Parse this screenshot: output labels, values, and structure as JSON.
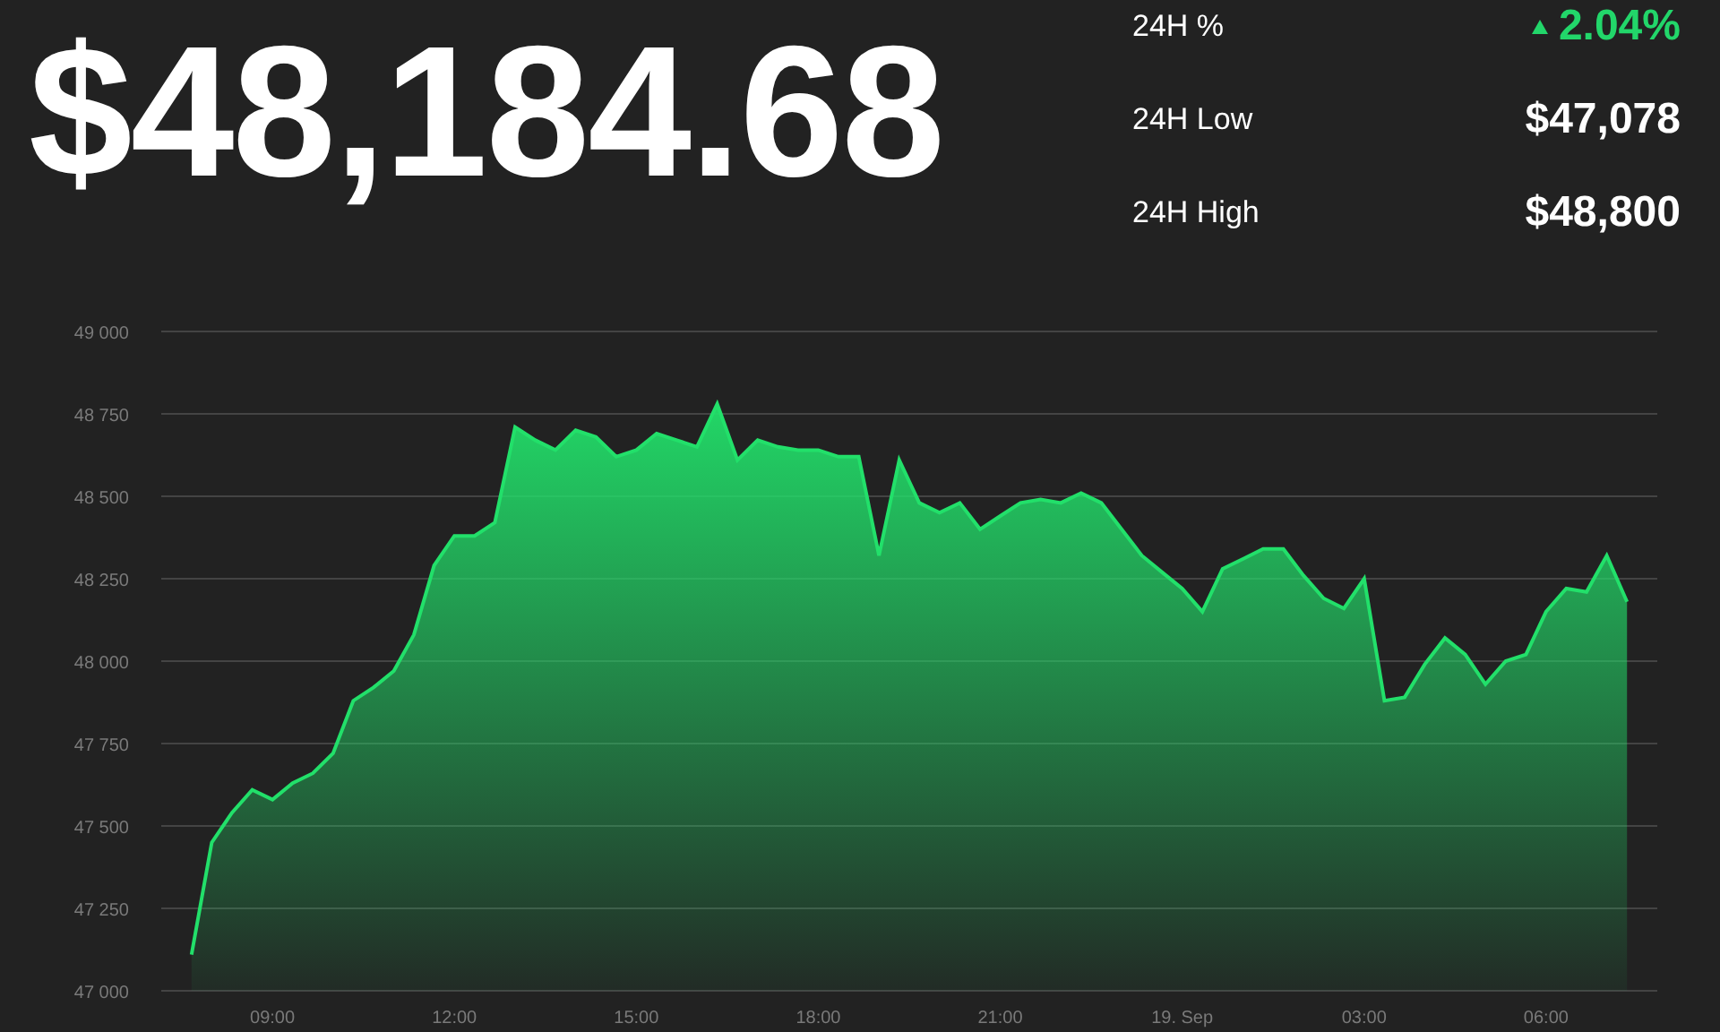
{
  "price": "$48,184.68",
  "stats": [
    {
      "label": "24H %",
      "value": "2.04%",
      "kind": "change",
      "rising": true
    },
    {
      "label": "24H Low",
      "value": "$47,078",
      "kind": "plain"
    },
    {
      "label": "24H High",
      "value": "$48,800",
      "kind": "plain"
    }
  ],
  "chart": {
    "chart_data": {
      "type": "area",
      "categories": [
        null,
        null,
        null,
        null,
        "09:00",
        null,
        null,
        null,
        null,
        null,
        null,
        null,
        null,
        "12:00",
        null,
        null,
        null,
        null,
        null,
        null,
        null,
        null,
        "15:00",
        null,
        null,
        null,
        null,
        null,
        null,
        null,
        null,
        "18:00",
        null,
        null,
        null,
        null,
        null,
        null,
        null,
        null,
        "21:00",
        null,
        null,
        null,
        null,
        null,
        null,
        null,
        null,
        "19. Sep",
        null,
        null,
        null,
        null,
        null,
        null,
        null,
        null,
        "03:00",
        null,
        null,
        null,
        null,
        null,
        null,
        null,
        null,
        "06:00",
        null,
        null,
        null,
        null
      ],
      "series": [
        {
          "color": "#22e06a",
          "values": [
            47110,
            47450,
            47540,
            47610,
            47580,
            47630,
            47660,
            47720,
            47880,
            47920,
            47970,
            48080,
            48290,
            48380,
            48380,
            48420,
            48710,
            48670,
            48640,
            48700,
            48680,
            48620,
            48640,
            48690,
            48670,
            48650,
            48780,
            48610,
            48670,
            48650,
            48640,
            48640,
            48620,
            48620,
            48320,
            48610,
            48480,
            48450,
            48480,
            48400,
            48440,
            48480,
            48490,
            48480,
            48510,
            48480,
            48400,
            48320,
            48270,
            48220,
            48150,
            48280,
            48310,
            48340,
            48340,
            48260,
            48190,
            48160,
            48250,
            47880,
            47890,
            47990,
            48070,
            48020,
            47930,
            48000,
            48020,
            48150,
            48220,
            48210,
            48320,
            48180
          ]
        }
      ],
      "ylim": [
        47000,
        49000
      ],
      "grid": true,
      "yticks": [
        {
          "value": 47000,
          "label": "47 000"
        },
        {
          "value": 47250,
          "label": "47 250"
        },
        {
          "value": 47500,
          "label": "47 500"
        },
        {
          "value": 47750,
          "label": "47 750"
        },
        {
          "value": 48000,
          "label": "48 000"
        },
        {
          "value": 48250,
          "label": "48 250"
        },
        {
          "value": 48500,
          "label": "48 500"
        },
        {
          "value": 48750,
          "label": "48 750"
        },
        {
          "value": 49000,
          "label": "49 000"
        }
      ]
    }
  }
}
